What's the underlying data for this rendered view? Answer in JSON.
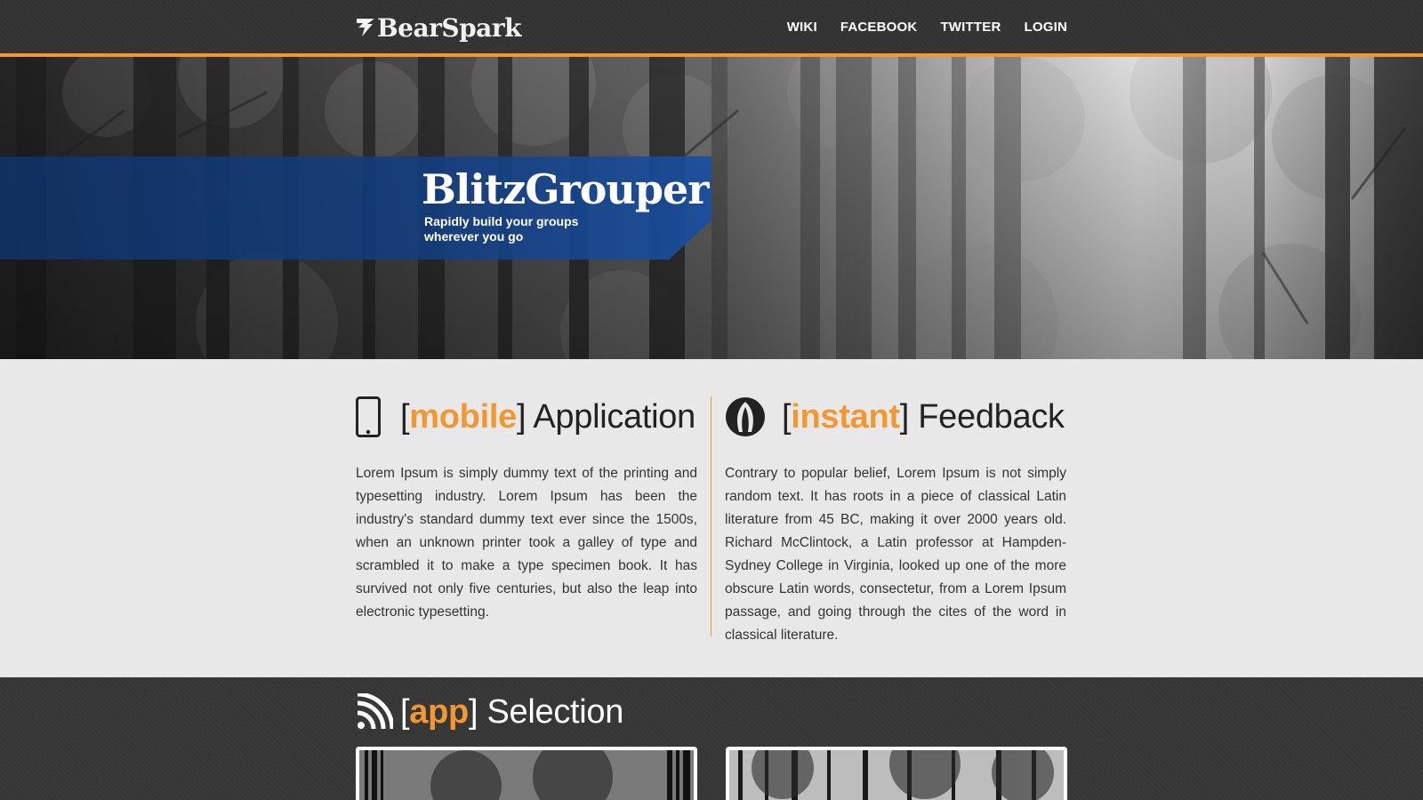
{
  "header": {
    "brand": "BearSpark",
    "nav": [
      {
        "label": "WIKI"
      },
      {
        "label": "FACEBOOK"
      },
      {
        "label": "TWITTER"
      },
      {
        "label": "LOGIN"
      }
    ]
  },
  "hero": {
    "title": "BlitzGrouper",
    "tagline": "Rapidly build your groups\nwherever you  go"
  },
  "features": [
    {
      "bracket_open": "[",
      "accent": "mobile",
      "bracket_close": "]",
      "title_rest": " Application",
      "icon": "smartphone-icon",
      "body": "Lorem Ipsum is simply dummy text of the printing and typesetting industry. Lorem Ipsum has been the industry's standard dummy text ever since the 1500s, when an unknown printer took a galley of type and scrambled it to make a type specimen book. It has survived not only five centuries, but also the leap into electronic typesetting."
    },
    {
      "bracket_open": "[",
      "accent": "instant",
      "bracket_close": "]",
      "title_rest": " Feedback",
      "icon": "rocket-icon",
      "body": "Contrary to popular belief, Lorem Ipsum is not simply random text. It has roots in a piece of classical Latin literature from 45 BC, making it over 2000 years old. Richard McClintock, a Latin professor at Hampden-Sydney College in Virginia, looked up one of the more obscure Latin words, consectetur, from a Lorem Ipsum passage, and going through the cites of the word in classical literature."
    }
  ],
  "apps": {
    "bracket_open": "[",
    "accent": "app",
    "bracket_close": "]",
    "title_rest": " Selection",
    "icon": "wifi-signal-icon"
  },
  "colors": {
    "accent": "#f39733",
    "header_bg": "#323232",
    "band_blue": "#123e82",
    "content_bg": "#e8e8e8",
    "apps_bg": "#353535"
  }
}
